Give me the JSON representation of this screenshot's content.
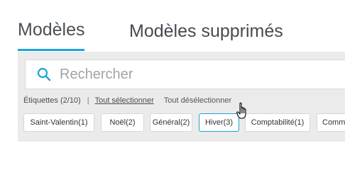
{
  "tabs": [
    {
      "label": "Modèles",
      "active": true
    },
    {
      "label": "Modèles supprimés",
      "active": false
    }
  ],
  "colors": {
    "accent": "#1aa5d6",
    "panel_bg": "#ebebeb"
  },
  "search": {
    "placeholder": "Rechercher",
    "value": "",
    "icon": "search-icon"
  },
  "labels": {
    "count_text": "Étiquettes (2/10)",
    "separator": "|",
    "select_all": "Tout sélectionner",
    "deselect_all": "Tout désélectionner"
  },
  "chips": [
    {
      "label": "Saint-Valentin(1)",
      "selected": false
    },
    {
      "label": "Noël(2)",
      "selected": false
    },
    {
      "label": "Général(2)",
      "selected": false
    },
    {
      "label": "Hiver(3)",
      "selected": true
    },
    {
      "label": "Comptabilité(1)",
      "selected": false
    },
    {
      "label": "Comm",
      "selected": false
    }
  ],
  "pointer": {
    "icon": "hand-pointer-icon"
  }
}
